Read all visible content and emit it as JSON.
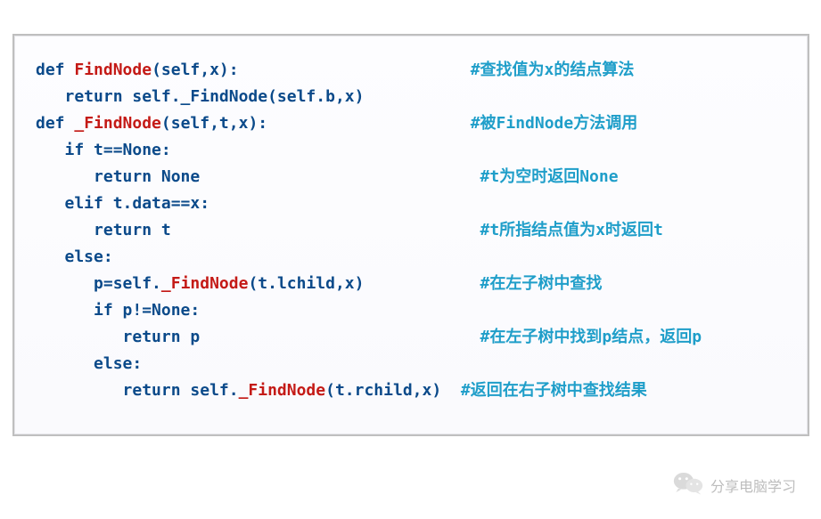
{
  "code": {
    "lines": [
      {
        "parts": [
          {
            "cls": "kw",
            "t": "def "
          },
          {
            "cls": "fn",
            "t": "FindNode"
          },
          {
            "cls": "txt",
            "t": "(self,x):"
          },
          {
            "cls": "txt",
            "t": "                        "
          },
          {
            "cls": "cm",
            "t": "#查找值为x的结点算法"
          }
        ]
      },
      {
        "parts": [
          {
            "cls": "txt",
            "t": "   return self._FindNode(self.b,x)"
          }
        ]
      },
      {
        "parts": [
          {
            "cls": "txt",
            "t": ""
          }
        ]
      },
      {
        "parts": [
          {
            "cls": "kw",
            "t": "def "
          },
          {
            "cls": "fn",
            "t": "_FindNode"
          },
          {
            "cls": "txt",
            "t": "(self,t,x):"
          },
          {
            "cls": "txt",
            "t": "                     "
          },
          {
            "cls": "cm",
            "t": "#被FindNode方法调用"
          }
        ]
      },
      {
        "parts": [
          {
            "cls": "txt",
            "t": "   if t==None:"
          }
        ]
      },
      {
        "parts": [
          {
            "cls": "txt",
            "t": "      return None"
          },
          {
            "cls": "txt",
            "t": "                             "
          },
          {
            "cls": "cm",
            "t": "#t为空时返回None"
          }
        ]
      },
      {
        "parts": [
          {
            "cls": "txt",
            "t": "   elif t.data==x:"
          }
        ]
      },
      {
        "parts": [
          {
            "cls": "txt",
            "t": "      return t"
          },
          {
            "cls": "txt",
            "t": "                                "
          },
          {
            "cls": "cm",
            "t": "#t所指结点值为x时返回t"
          }
        ]
      },
      {
        "parts": [
          {
            "cls": "txt",
            "t": "   else:"
          }
        ]
      },
      {
        "parts": [
          {
            "cls": "txt",
            "t": "      p=self."
          },
          {
            "cls": "fn",
            "t": "_FindNode"
          },
          {
            "cls": "txt",
            "t": "(t.lchild,x)"
          },
          {
            "cls": "txt",
            "t": "            "
          },
          {
            "cls": "cm",
            "t": "#在左子树中查找"
          }
        ]
      },
      {
        "parts": [
          {
            "cls": "txt",
            "t": "      if p!=None:"
          }
        ]
      },
      {
        "parts": [
          {
            "cls": "txt",
            "t": "         return p"
          },
          {
            "cls": "txt",
            "t": "                             "
          },
          {
            "cls": "cm",
            "t": "#在左子树中找到p结点，返回p"
          }
        ]
      },
      {
        "parts": [
          {
            "cls": "txt",
            "t": "      else:"
          }
        ]
      },
      {
        "parts": [
          {
            "cls": "txt",
            "t": "         return self."
          },
          {
            "cls": "fn",
            "t": "_FindNode"
          },
          {
            "cls": "txt",
            "t": "(t.rchild,x)"
          },
          {
            "cls": "txt",
            "t": "  "
          },
          {
            "cls": "cm",
            "t": "#返回在右子树中查找结果"
          }
        ]
      }
    ]
  },
  "watermark": {
    "text": "分享电脑学习"
  }
}
